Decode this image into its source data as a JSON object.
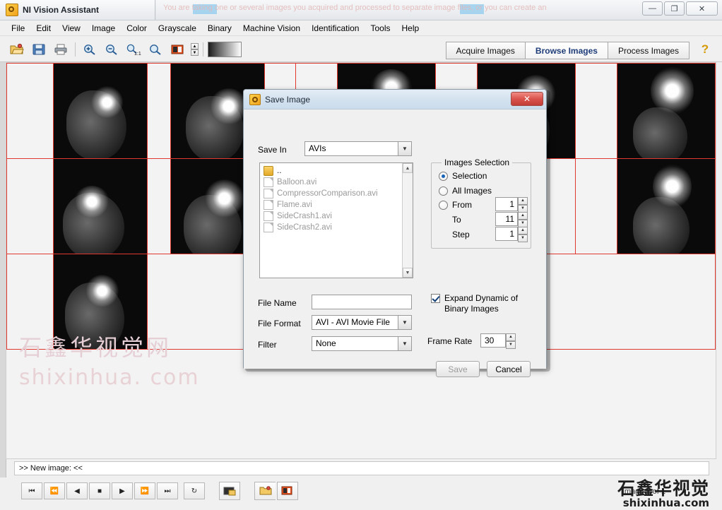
{
  "window": {
    "title": "NI Vision Assistant",
    "icon": "ni-vision-icon",
    "ghost_text": "You are taking one or several images you acquired and processed to separate image files, or you can create an",
    "buttons": {
      "minimize": "—",
      "maximize": "❐",
      "close": "✕"
    }
  },
  "menubar": {
    "items": [
      "File",
      "Edit",
      "View",
      "Image",
      "Color",
      "Grayscale",
      "Binary",
      "Machine Vision",
      "Identification",
      "Tools",
      "Help"
    ]
  },
  "toolbar": {
    "tabs": [
      {
        "label": "Acquire Images",
        "active": false
      },
      {
        "label": "Browse Images",
        "active": true
      },
      {
        "label": "Process Images",
        "active": false
      }
    ],
    "help_glyph": "?",
    "icons": [
      "open-image-icon",
      "save-image-icon",
      "print-icon",
      "zoom-in-icon",
      "zoom-out-icon",
      "zoom-1to1-icon",
      "zoom-fit-icon",
      "image-properties-icon"
    ]
  },
  "browser": {
    "watermark_cn": "石鑫华视觉网",
    "watermark_en": "shixinhua. com"
  },
  "status": {
    "text": ">> New image:  <<"
  },
  "bottom": {
    "transport": [
      "first-frame",
      "rewind",
      "step-back",
      "stop",
      "play",
      "forward",
      "last-frame",
      "loop"
    ],
    "image_count": "Image 1 of 1",
    "watermark_cn": "石鑫华视觉",
    "watermark_en": "shixinhua.com"
  },
  "dialog": {
    "title": "Save Image",
    "icon": "ni-vision-icon",
    "close_label": "✕",
    "save_in": {
      "label": "Save In",
      "value": "AVIs"
    },
    "files": [
      {
        "name": "..",
        "type": "folder",
        "enabled": true
      },
      {
        "name": "Balloon.avi",
        "type": "file",
        "enabled": false
      },
      {
        "name": "CompressorComparison.avi",
        "type": "file",
        "enabled": false
      },
      {
        "name": "Flame.avi",
        "type": "file",
        "enabled": false
      },
      {
        "name": "SideCrash1.avi",
        "type": "file",
        "enabled": false
      },
      {
        "name": "SideCrash2.avi",
        "type": "file",
        "enabled": false
      }
    ],
    "images_selection": {
      "group_label": "Images Selection",
      "options": [
        {
          "label": "Selection",
          "checked": true
        },
        {
          "label": "All Images",
          "checked": false
        },
        {
          "label": "From",
          "checked": false
        }
      ],
      "from_value": "1",
      "to_label": "To",
      "to_value": "11",
      "step_label": "Step",
      "step_value": "1"
    },
    "file_name": {
      "label": "File Name",
      "value": "",
      "placeholder": ""
    },
    "file_format": {
      "label": "File Format",
      "value": "AVI - AVI Movie File"
    },
    "filter": {
      "label": "Filter",
      "value": "None"
    },
    "expand_dynamic": {
      "label_line1": "Expand Dynamic of",
      "label_line2": "Binary Images",
      "checked": true
    },
    "frame_rate": {
      "label": "Frame Rate",
      "value": "30"
    },
    "save_button": "Save",
    "cancel_button": "Cancel"
  }
}
